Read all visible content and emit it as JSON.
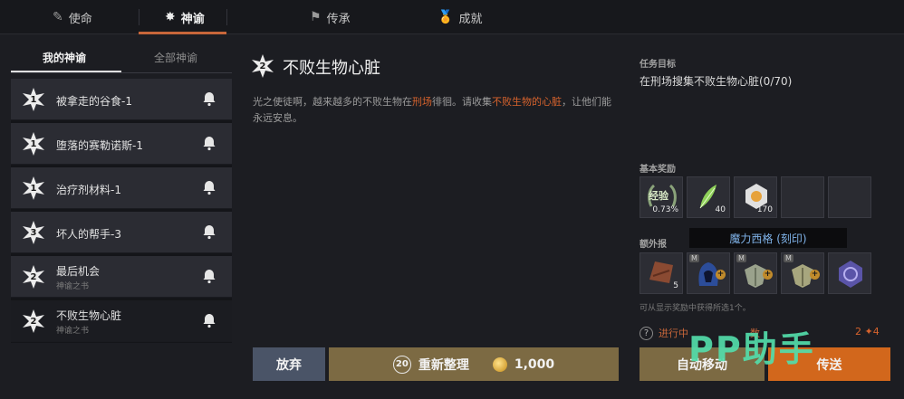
{
  "topnav": {
    "tabs": [
      {
        "label": "使命",
        "icon": "feather-icon"
      },
      {
        "label": "神谕",
        "icon": "star-burst-icon"
      },
      {
        "label": "传承",
        "icon": "flag-icon"
      },
      {
        "label": "成就",
        "icon": "medal-icon"
      }
    ],
    "active_index": 1
  },
  "left": {
    "subtabs": [
      "我的神谕",
      "全部神谕"
    ],
    "items": [
      {
        "num": "1",
        "title": "被拿走的谷食-1",
        "sub": ""
      },
      {
        "num": "1",
        "title": "堕落的赛勒诺斯-1",
        "sub": ""
      },
      {
        "num": "1",
        "title": "治疗剂材料-1",
        "sub": ""
      },
      {
        "num": "3",
        "title": "坏人的帮手-3",
        "sub": ""
      },
      {
        "num": "2",
        "title": "最后机会",
        "sub": "神谕之书"
      },
      {
        "num": "2",
        "title": "不败生物心脏",
        "sub": "神谕之书"
      }
    ],
    "selected_index": 5
  },
  "quest": {
    "num": "2",
    "title": "不败生物心脏",
    "desc_1": "光之使徒啊，越来越多的不败生物在",
    "desc_hl1": "刑场",
    "desc_2": "徘徊。请收集",
    "desc_hl2": "不败生物的心脏",
    "desc_3": "，让他们能永远安息。"
  },
  "right": {
    "objective_label": "任务目标",
    "objective_text": "在刑场搜集不败生物心脏(0/70)",
    "basic_label": "基本奖励",
    "basic_rewards": [
      {
        "name": "exp",
        "text": "经验",
        "count": "0.73%"
      },
      {
        "name": "herb",
        "count": "40"
      },
      {
        "name": "crystal",
        "count": "170"
      }
    ],
    "extra_label": "额外报",
    "tooltip": "魔力西格 (刻印)",
    "extra_rewards": [
      {
        "name": "leather",
        "count": "5"
      },
      {
        "name": "hood",
        "mark": "M"
      },
      {
        "name": "shield",
        "mark": "M"
      },
      {
        "name": "shield",
        "mark": "M"
      },
      {
        "name": "rune-stone"
      }
    ],
    "hint": "可从显示奖励中获得所选1个。",
    "progress": "进行中",
    "progress_tail": "数",
    "count_a": "2",
    "count_b": "4"
  },
  "buttons": {
    "abandon": "放弃",
    "reorg": "重新整理",
    "reorg_cost_count": "20",
    "reorg_gold": "1,000",
    "auto_move": "自动移动",
    "teleport": "传送"
  },
  "watermark": "PP助手",
  "colors": {
    "accent": "#c8663a",
    "highlight": "#d7632d",
    "teleport": "#d2671c"
  }
}
